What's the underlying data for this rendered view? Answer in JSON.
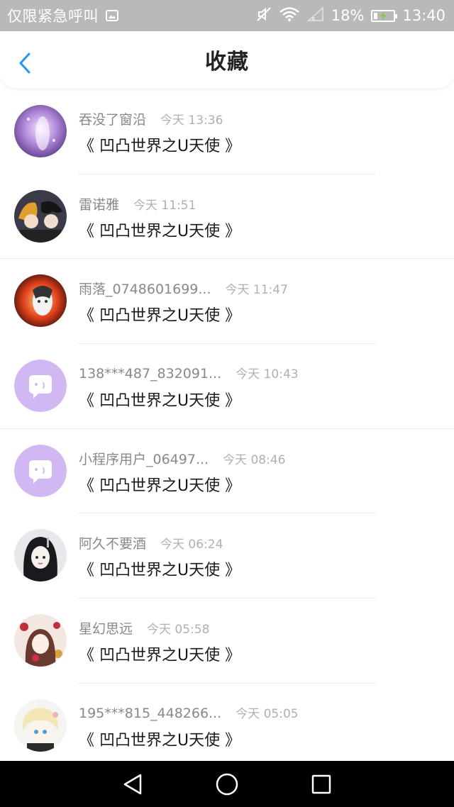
{
  "status_bar": {
    "carrier": "仅限紧急呼叫",
    "battery_percent": "18%",
    "battery_level": 0.18,
    "time": "13:40"
  },
  "header": {
    "title": "收藏",
    "back_icon": "chevron-left-icon",
    "accent_color": "#2196f3"
  },
  "favorites": [
    {
      "username": "吞没了窗沿",
      "time": "今天 13:36",
      "title": "《 凹凸世界之U天使 》",
      "avatar": "purple-galaxy"
    },
    {
      "username": "雷诺雅",
      "time": "今天 11:51",
      "title": "《 凹凸世界之U天使 》",
      "avatar": "anime-duo"
    },
    {
      "username": "雨落_0748601699...",
      "time": "今天 11:47",
      "title": "《 凹凸世界之U天使 》",
      "avatar": "fire-character"
    },
    {
      "username": "138***487_832091...",
      "time": "今天 10:43",
      "title": "《 凹凸世界之U天使 》",
      "avatar": "default-chat"
    },
    {
      "username": "小程序用户_06497...",
      "time": "今天 08:46",
      "title": "《 凹凸世界之U天使 》",
      "avatar": "default-chat"
    },
    {
      "username": "阿久不要酒",
      "time": "今天 06:24",
      "title": "《 凹凸世界之U天使 》",
      "avatar": "dark-hair-girl"
    },
    {
      "username": "星幻思远",
      "time": "今天 05:58",
      "title": "《 凹凸世界之U天使 》",
      "avatar": "floral-girl"
    },
    {
      "username": "195***815_448266...",
      "time": "今天 05:05",
      "title": "《 凹凸世界之U天使 》",
      "avatar": "blonde-character"
    }
  ],
  "nav_bar": {
    "back": "triangle-back-icon",
    "home": "circle-home-icon",
    "recents": "square-recents-icon"
  }
}
